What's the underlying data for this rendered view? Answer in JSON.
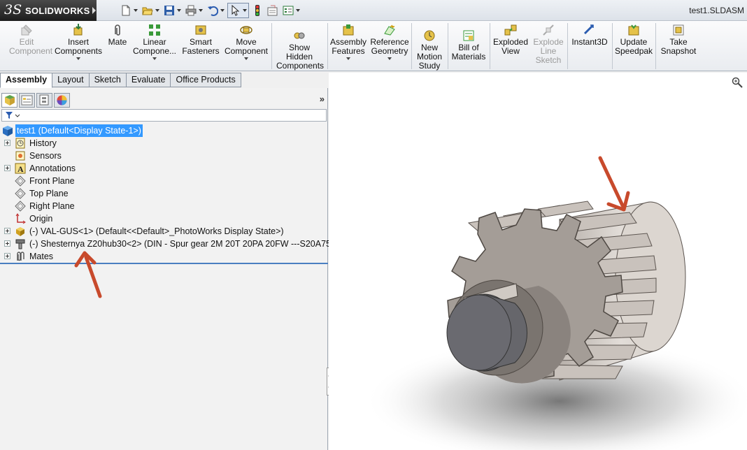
{
  "app": {
    "logo_ds": "3S",
    "logo_text": "SOLIDWORKS",
    "filename": "test1.SLDASM"
  },
  "quick_access": [
    {
      "name": "new-document-icon",
      "dropdown": true
    },
    {
      "name": "open-folder-icon",
      "dropdown": true
    },
    {
      "name": "save-icon",
      "dropdown": true
    },
    {
      "name": "print-icon",
      "dropdown": true
    },
    {
      "name": "undo-icon",
      "dropdown": true
    },
    {
      "name": "select-arrow-icon",
      "dropdown": true
    },
    {
      "name": "rebuild-traffic-light-icon",
      "dropdown": false
    },
    {
      "name": "file-properties-icon",
      "dropdown": false
    },
    {
      "name": "options-icon",
      "dropdown": true
    }
  ],
  "ribbon": {
    "edit_component": "Edit Component",
    "insert_components": "Insert Components",
    "mate": "Mate",
    "linear_component": "Linear Compone...",
    "smart_fasteners": "Smart Fasteners",
    "move_component": "Move Component",
    "show_hidden": "Show Hidden Components",
    "assembly_features": "Assembly Features",
    "reference_geometry": "Reference Geometry",
    "new_motion_study": "New Motion Study",
    "bill_of_materials": "Bill of Materials",
    "exploded_view": "Exploded View",
    "explode_line_sketch": "Explode Line Sketch",
    "instant3d": "Instant3D",
    "update_speedpak": "Update Speedpak",
    "take_snapshot": "Take Snapshot"
  },
  "tabs": [
    "Assembly",
    "Layout",
    "Sketch",
    "Evaluate",
    "Office Products"
  ],
  "tree": {
    "root": "test1  (Default<Display State-1>)",
    "items": [
      "History",
      "Sensors",
      "Annotations",
      "Front Plane",
      "Top Plane",
      "Right Plane",
      "Origin",
      "(-) VAL-GUS<1> (Default<<Default>_PhotoWorks Display State>)",
      "(-) Shesternya Z20hub30<2> (DIN - Spur gear 2M 20T 20PA 20FW ---S20A75H50L",
      "Mates"
    ]
  },
  "colors": {
    "selection": "#3399ff",
    "annotation_arrow": "#c84a2c",
    "gear_face": "#8a8480",
    "gear_light": "#d8d2cc",
    "shaft": "#5c5c60"
  }
}
